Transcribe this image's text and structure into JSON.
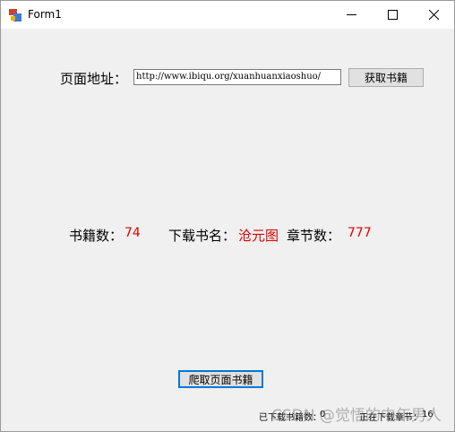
{
  "window": {
    "title": "Form1"
  },
  "form": {
    "url_label": "页面地址：",
    "url_value": "http://www.ibiqu.org/xuanhuanxiaoshuo/",
    "fetch_button": "获取书籍",
    "book_count_label": "书籍数：",
    "book_count_value": "74",
    "download_name_label": "下载书名：",
    "download_name_value": "沧元图",
    "chapter_count_label": "章节数：",
    "chapter_count_value": "777",
    "crawl_button": "爬取页面书籍"
  },
  "status": {
    "downloaded_label": "已下载书籍数：",
    "downloaded_value": "0",
    "downloading_label": "正在下载章节：",
    "downloading_value": "16"
  },
  "watermark": "CSDN @觉悟的中年男人",
  "colors": {
    "accent_red": "#e00000",
    "focus_blue": "#0078d7"
  }
}
